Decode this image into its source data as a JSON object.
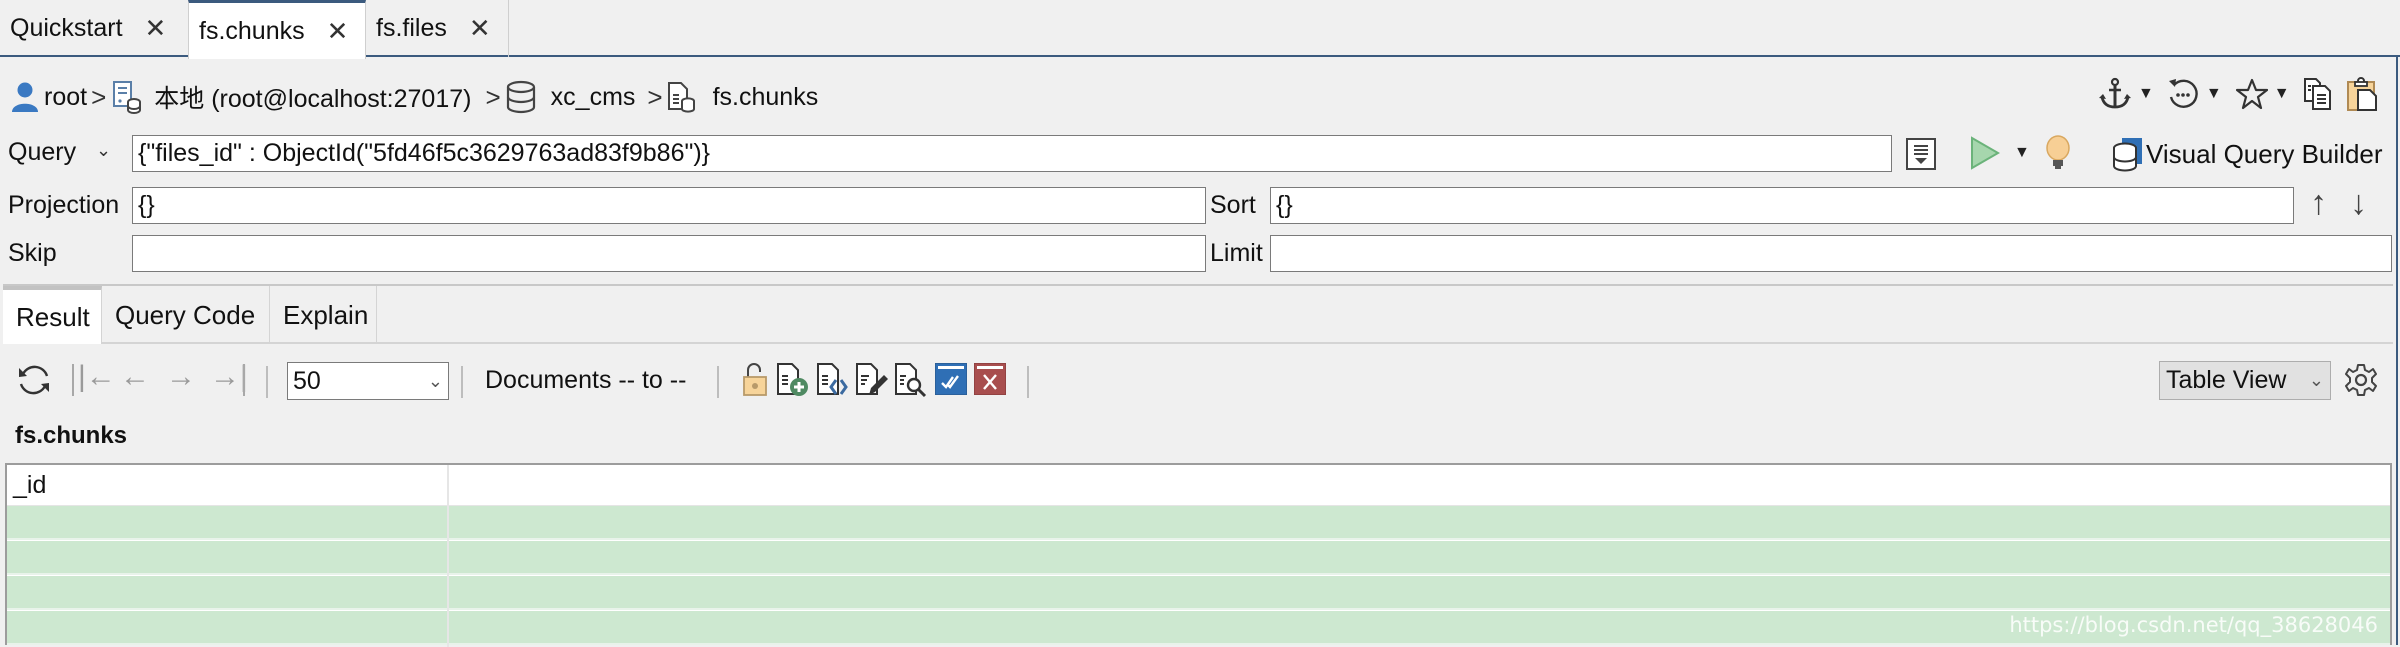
{
  "tabs": [
    {
      "label": "Quickstart",
      "active": false
    },
    {
      "label": "fs.chunks",
      "active": true
    },
    {
      "label": "fs.files",
      "active": false
    }
  ],
  "breadcrumb": {
    "user": "root",
    "connection": "本地 (root@localhost:27017)",
    "database": "xc_cms",
    "collection": "fs.chunks",
    "separator": ">"
  },
  "toolbar_top": {
    "anchor_icon": "anchor-icon",
    "history_icon": "history-icon",
    "favorite_icon": "star-icon",
    "copy_icon": "copy-icon",
    "paste_icon": "paste-icon"
  },
  "query": {
    "query_label": "Query",
    "query_value": "{\"files_id\" : ObjectId(\"5fd46f5c3629763ad83f9b86\")}",
    "projection_label": "Projection",
    "projection_value": "{}",
    "sort_label": "Sort",
    "sort_value": "{}",
    "skip_label": "Skip",
    "skip_value": "",
    "limit_label": "Limit",
    "limit_value": "",
    "visual_query_builder_label": "Visual Query Builder",
    "sort_up": "↑",
    "sort_down": "↓"
  },
  "result_tabs": [
    {
      "label": "Result",
      "active": true
    },
    {
      "label": "Query Code",
      "active": false
    },
    {
      "label": "Explain",
      "active": false
    }
  ],
  "result_toolbar": {
    "page_size": "50",
    "documents_label": "Documents -- to --",
    "view_mode": "Table View",
    "nav": {
      "first": "|←",
      "prev": "←",
      "next": "→",
      "last": "→|"
    }
  },
  "collection_label": "fs.chunks",
  "table": {
    "columns": [
      "_id",
      ""
    ],
    "rows": [
      [
        "",
        ""
      ],
      [
        "",
        ""
      ],
      [
        "",
        ""
      ],
      [
        "",
        ""
      ]
    ],
    "row_color": "#cde8d0"
  },
  "watermark": "https://blog.csdn.net/qq_38628046",
  "colors": {
    "accent": "#3b5a7e",
    "run_green": "#8fc79a",
    "bulb": "#f7cf95",
    "check_blue": "#2f6fb5",
    "delete_red": "#a84e4e"
  }
}
